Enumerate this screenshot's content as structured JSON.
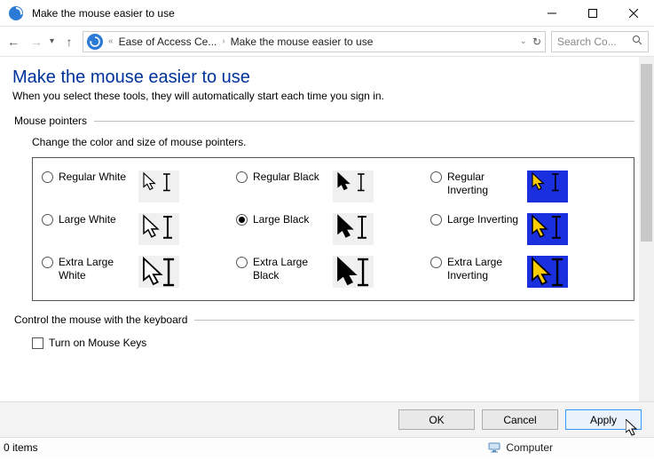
{
  "window": {
    "title": "Make the mouse easier to use"
  },
  "nav": {
    "crumb1": "Ease of Access Ce...",
    "crumb2": "Make the mouse easier to use",
    "dblchevron": "«",
    "search_placeholder": "Search Co..."
  },
  "page": {
    "heading": "Make the mouse easier to use",
    "subheading": "When you select these tools, they will automatically start each time you sign in."
  },
  "groups": {
    "pointers": {
      "legend": "Mouse pointers",
      "desc": "Change the color and size of mouse pointers.",
      "options": [
        {
          "label": "Regular White",
          "checked": false,
          "scheme": "white",
          "size": 1
        },
        {
          "label": "Regular Black",
          "checked": false,
          "scheme": "black",
          "size": 1
        },
        {
          "label": "Regular Inverting",
          "checked": false,
          "scheme": "invert",
          "size": 1
        },
        {
          "label": "Large White",
          "checked": false,
          "scheme": "white",
          "size": 2
        },
        {
          "label": "Large Black",
          "checked": true,
          "scheme": "black",
          "size": 2
        },
        {
          "label": "Large Inverting",
          "checked": false,
          "scheme": "invert",
          "size": 2
        },
        {
          "label": "Extra Large White",
          "checked": false,
          "scheme": "white",
          "size": 3
        },
        {
          "label": "Extra Large Black",
          "checked": false,
          "scheme": "black",
          "size": 3
        },
        {
          "label": "Extra Large Inverting",
          "checked": false,
          "scheme": "invert",
          "size": 3
        }
      ]
    },
    "keyboard": {
      "legend": "Control the mouse with the keyboard",
      "mousekeys_label": "Turn on Mouse Keys",
      "mousekeys_checked": false
    }
  },
  "buttons": {
    "ok": "OK",
    "cancel": "Cancel",
    "apply": "Apply"
  },
  "status": {
    "items": "0 items",
    "computer": "Computer"
  }
}
